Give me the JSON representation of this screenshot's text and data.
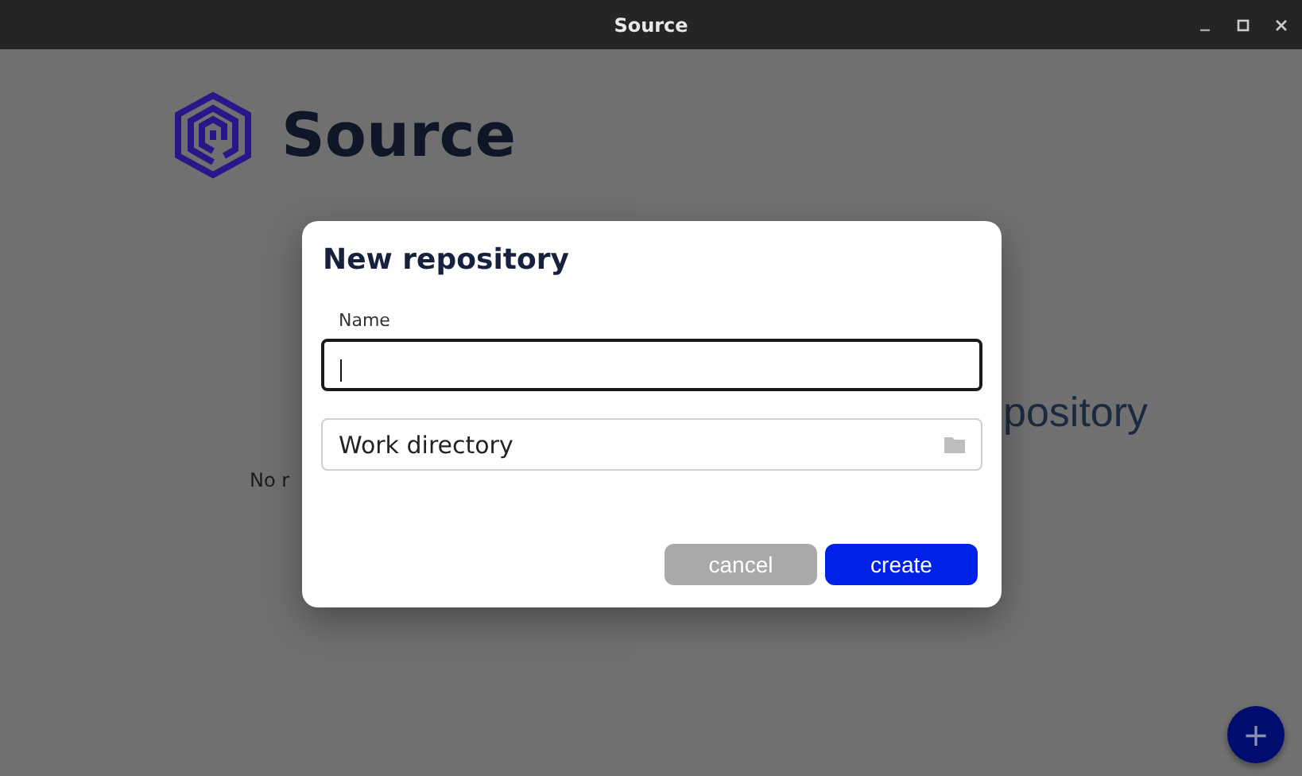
{
  "window": {
    "title": "Source"
  },
  "brand": {
    "name": "Source"
  },
  "left_panel": {
    "message": "No r"
  },
  "right_panel": {
    "message": "pository"
  },
  "dialog": {
    "title": "New repository",
    "fields": [
      {
        "kind": "text",
        "label": "Name",
        "focused": true
      },
      {
        "kind": "folder",
        "placeholder": "Work directory",
        "focused": false
      }
    ],
    "buttons": [
      {
        "label": "cancel",
        "primary": false
      },
      {
        "label": "create",
        "primary": true
      }
    ]
  },
  "fab": {
    "label": "+"
  }
}
